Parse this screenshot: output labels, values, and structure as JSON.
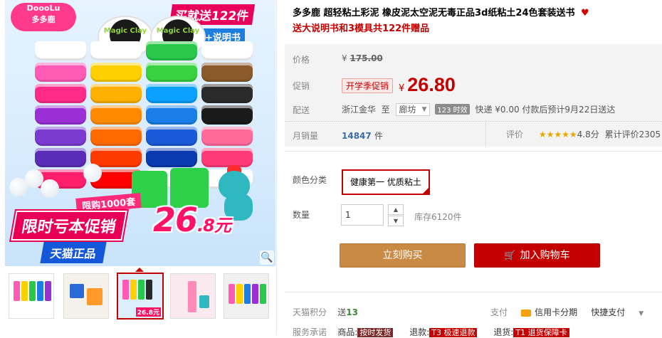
{
  "gallery": {
    "logo": {
      "top": "DoooLu",
      "bottom": "多多鹿"
    },
    "promo_top_line1": "买就送122件",
    "promo_top_line2": "赠品+说明书",
    "lid_text_1": "Magic Clay",
    "lid_text_2": "Magic Clay",
    "limit_strip": "限购1000套",
    "sale_title": "限时亏本促销",
    "big_price_main": "26",
    "big_price_rest": ".8元",
    "tmall_tag": "天猫正品",
    "thumb_tag": "26.8元",
    "jar_colors": [
      "#ffffff",
      "#ff5bb5",
      "#ff2a8a",
      "#9b2fd6",
      "#7b3ad0",
      "#5a2db8",
      "#ff1f6a"
    ],
    "jar_colors_2": [
      "#ffffff",
      "#ffd000",
      "#ffb000",
      "#ff8a00",
      "#ff6a00",
      "#ff3a00",
      "#ff0000"
    ],
    "jar_colors_3": [
      "#2ac84a",
      "#38d240",
      "#0aa0ff",
      "#1a7ee8",
      "#1a5ad8",
      "#0a3ab0",
      "#ffffff"
    ],
    "jar_colors_4": [
      "#ffffff",
      "#8a5a2a",
      "#2a2a2a",
      "#1a1a1a",
      "#ff6a9a",
      "#ff3a7a",
      "#ffffff"
    ]
  },
  "product": {
    "title_main": "多多鹿 超轻粘土彩泥 橡皮泥太空泥无毒正品3d纸粘土24色套装送书",
    "title_sub": "送大说明书和3模具共122件赠品",
    "heart_icon": "♥"
  },
  "price": {
    "label": "价格",
    "currency": "¥",
    "original": "175.00",
    "promo_label": "促销",
    "promo_badge": "开学季促销",
    "promo_currency": "¥",
    "promo_value": "26.80"
  },
  "shipping": {
    "label": "配送",
    "from": "浙江金华",
    "to_word": "至",
    "dest": "廊坊",
    "badge": "123 时效",
    "text": "快递 ¥0.00 付款后预计9月22日送达"
  },
  "sales": {
    "label": "月销量",
    "count": "14847",
    "unit": "件",
    "rating_label": "评价",
    "stars": "★★★★★",
    "score": "4.8分",
    "total": "累计评价2305"
  },
  "sku": {
    "color_label": "颜色分类",
    "color_option": "健康第一 优质粘土",
    "qty_label": "数量",
    "qty_value": "1",
    "stepper_up": "▲",
    "stepper_down": "▼",
    "stock": "库存6120件"
  },
  "actions": {
    "buy": "立刻购买",
    "cart": "加入购物车",
    "cart_icon": "🛒"
  },
  "extras": {
    "points_label": "天猫积分",
    "points_prefix": "送",
    "points_value": "13",
    "pay_label": "支付",
    "pay_credit": "信用卡分期",
    "pay_quick": "快捷支付",
    "pay_dropdown": "▼",
    "service_label": "服务承诺",
    "svc1_prefix": "商品:",
    "svc1_tag": "按时发货",
    "svc2_prefix": "退款:",
    "svc2_tag": "T3 极速退款",
    "svc3_prefix": "退货:",
    "svc3_tag": "T1 退货保障卡"
  }
}
